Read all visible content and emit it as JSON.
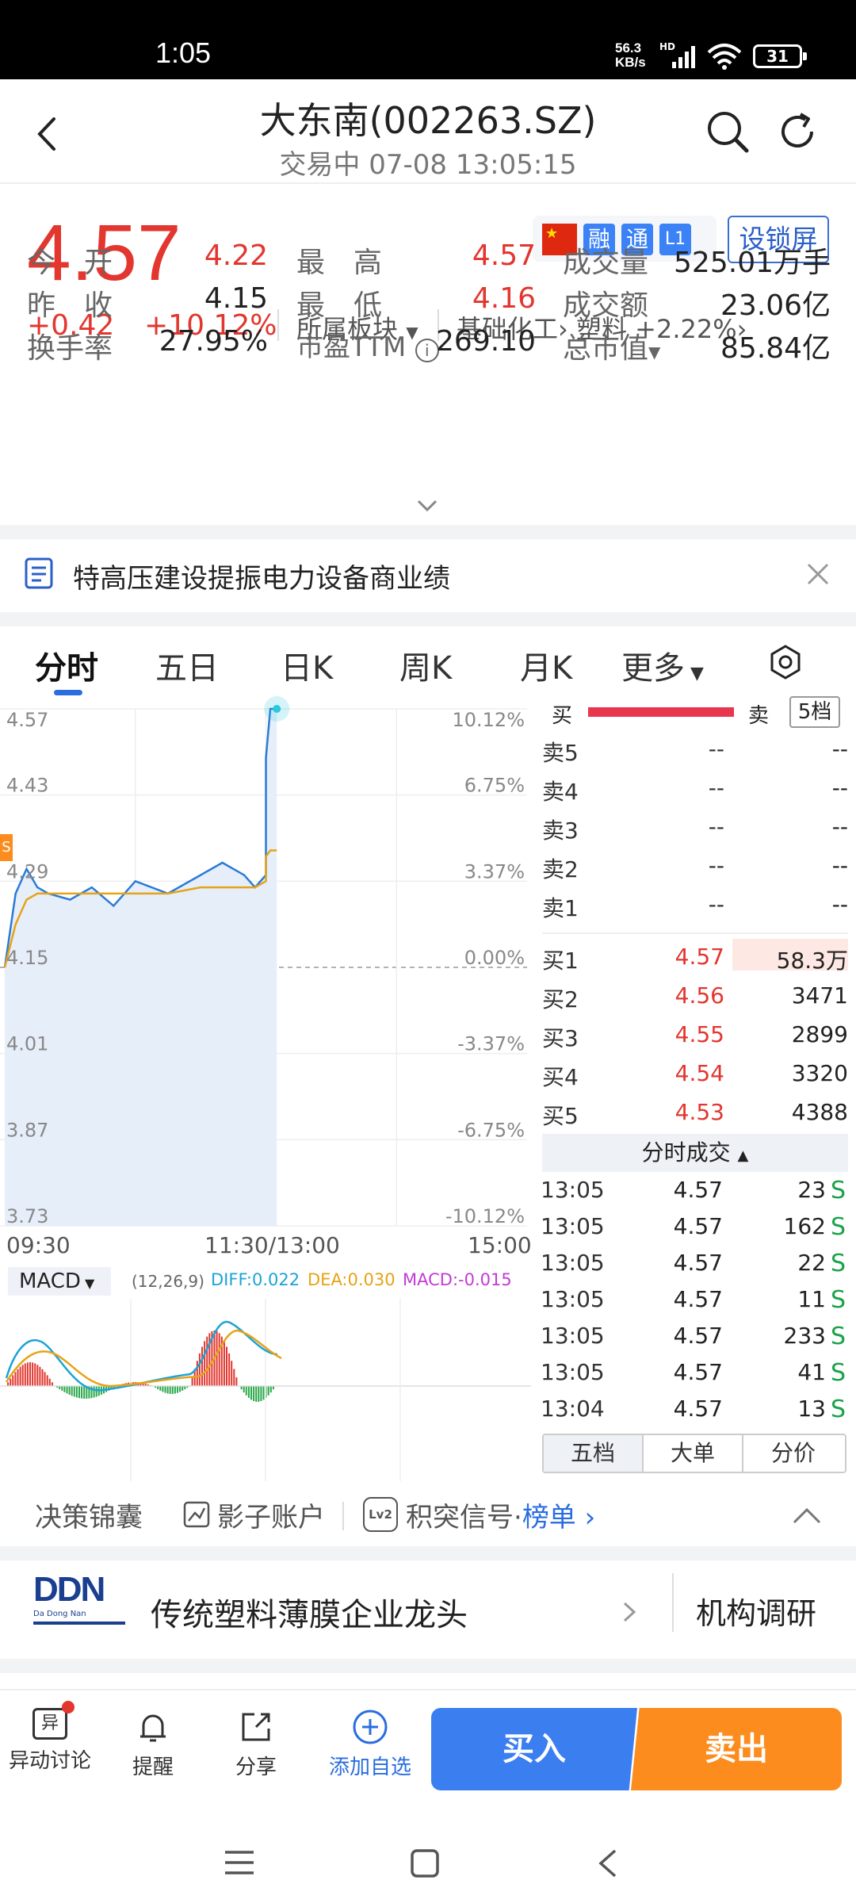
{
  "status": {
    "time": "1:05",
    "net_speed": "56.3",
    "net_unit": "KB/s",
    "hd": "HD",
    "battery": "31"
  },
  "header": {
    "title": "大东南(002263.SZ)",
    "subtitle": "交易中 07-08 13:05:15"
  },
  "quote": {
    "price": "4.57",
    "change": "+0.42",
    "change_pct": "+10.12%",
    "sector_label": "所属板块",
    "industry": "基础化工",
    "sub_industry": "塑料",
    "sub_industry_chg": "+2.22%",
    "tags": [
      "融",
      "通",
      "L1"
    ],
    "lock_button": "设锁屏",
    "stats": [
      {
        "label": "今　开",
        "value": "4.22",
        "color": "#e2362f"
      },
      {
        "label": "最　高",
        "value": "4.57",
        "color": "#e2362f"
      },
      {
        "label": "成交量",
        "value": "525.01万手",
        "color": "#222222"
      },
      {
        "label": "昨　收",
        "value": "4.15",
        "color": "#222222"
      },
      {
        "label": "最　低",
        "value": "4.16",
        "color": "#e2362f"
      },
      {
        "label": "成交额",
        "value": "23.06亿",
        "color": "#222222"
      },
      {
        "label": "换手率",
        "value": "27.95%",
        "color": "#222222"
      },
      {
        "label": "市盈TTM",
        "value": "269.10",
        "color": "#222222"
      },
      {
        "label": "总市值",
        "value": "85.84亿",
        "color": "#222222"
      }
    ]
  },
  "news": {
    "text": "特高压建设提振电力设备商业绩"
  },
  "tabs": [
    {
      "label": "分时"
    },
    {
      "label": "五日"
    },
    {
      "label": "日K"
    },
    {
      "label": "周K"
    },
    {
      "label": "月K"
    },
    {
      "label": "更多"
    }
  ],
  "chart": {
    "left_axis": [
      "4.57",
      "4.43",
      "4.29",
      "4.15",
      "4.01",
      "3.87",
      "3.73"
    ],
    "right_axis": [
      "10.12%",
      "6.75%",
      "3.37%",
      "0.00%",
      "-3.37%",
      "-6.75%",
      "-10.12%"
    ],
    "time_axis": [
      "09:30",
      "11:30/13:00",
      "15:00"
    ],
    "macd_label": "MACD",
    "macd_params": "(12,26,9)",
    "diff": "DIFF:0.022",
    "dea": "DEA:0.030",
    "macd": "MACD:-0.015",
    "marker": "S"
  },
  "chart_data": {
    "type": "line",
    "title": "",
    "xlabel": "",
    "ylabel": "",
    "x": [
      "09:30",
      "09:35",
      "09:40",
      "09:45",
      "09:50",
      "10:00",
      "10:10",
      "10:20",
      "10:30",
      "10:45",
      "11:00",
      "11:10",
      "11:20",
      "11:25",
      "11:30",
      "13:00",
      "13:02",
      "13:05"
    ],
    "ylim": [
      3.73,
      4.57
    ],
    "series": [
      {
        "name": "",
        "values": [
          4.15,
          4.27,
          4.31,
          4.28,
          4.27,
          4.26,
          4.28,
          4.25,
          4.29,
          4.27,
          4.3,
          4.32,
          4.3,
          4.28,
          4.3,
          4.49,
          4.57,
          4.57
        ]
      },
      {
        "name": "",
        "values": [
          4.15,
          4.22,
          4.26,
          4.27,
          4.27,
          4.27,
          4.27,
          4.27,
          4.27,
          4.27,
          4.28,
          4.28,
          4.28,
          4.28,
          4.29,
          4.33,
          4.34,
          4.34
        ]
      }
    ]
  },
  "orderbook": {
    "header_buy": "买",
    "header_sell": "卖",
    "level_btn": "5档",
    "asks": [
      {
        "label": "卖5",
        "price": "--",
        "vol": "--"
      },
      {
        "label": "卖4",
        "price": "--",
        "vol": "--"
      },
      {
        "label": "卖3",
        "price": "--",
        "vol": "--"
      },
      {
        "label": "卖2",
        "price": "--",
        "vol": "--"
      },
      {
        "label": "卖1",
        "price": "--",
        "vol": "--"
      }
    ],
    "bids": [
      {
        "label": "买1",
        "price": "4.57",
        "vol": "58.3万"
      },
      {
        "label": "买2",
        "price": "4.56",
        "vol": "3471"
      },
      {
        "label": "买3",
        "price": "4.55",
        "vol": "2899"
      },
      {
        "label": "买4",
        "price": "4.54",
        "vol": "3320"
      },
      {
        "label": "买5",
        "price": "4.53",
        "vol": "4388"
      }
    ],
    "ticks_title": "分时成交",
    "ticks": [
      {
        "time": "13:05",
        "price": "4.57",
        "vol": "23",
        "side": "S"
      },
      {
        "time": "13:05",
        "price": "4.57",
        "vol": "162",
        "side": "S"
      },
      {
        "time": "13:05",
        "price": "4.57",
        "vol": "22",
        "side": "S"
      },
      {
        "time": "13:05",
        "price": "4.57",
        "vol": "11",
        "side": "S"
      },
      {
        "time": "13:05",
        "price": "4.57",
        "vol": "233",
        "side": "S"
      },
      {
        "time": "13:05",
        "price": "4.57",
        "vol": "41",
        "side": "S"
      },
      {
        "time": "13:04",
        "price": "4.57",
        "vol": "13",
        "side": "S"
      }
    ],
    "bottom_tabs": [
      "五档",
      "大单",
      "分价"
    ]
  },
  "tools": {
    "item1": "决策锦囊",
    "item2": "影子账户",
    "item3_prefix": "积突信号·",
    "item3_link": "榜单",
    "lv2": "Lv2"
  },
  "promo": {
    "text": "传统塑料薄膜企业龙头",
    "right": "机构调研",
    "logo": "DDN",
    "logo_sub": "Da Dong Nan"
  },
  "bottom": {
    "items": [
      {
        "label": "异动讨论"
      },
      {
        "label": "提醒"
      },
      {
        "label": "分享"
      },
      {
        "label": "添加自选"
      }
    ],
    "buy": "买入",
    "sell": "卖出",
    "discuss_glyph": "异"
  }
}
